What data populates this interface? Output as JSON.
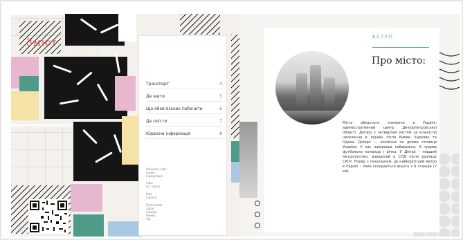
{
  "toc": {
    "title": "3міст",
    "items": [
      {
        "label": "Транспорт",
        "page": "4"
      },
      {
        "label": "Де жити",
        "page": "5"
      },
      {
        "label": "Що обов’язково побачити",
        "page": "6"
      },
      {
        "label": "Де поїсти",
        "page": "7"
      },
      {
        "label": "Корисна інформація",
        "page": "8"
      }
    ],
    "small_notes": [
      "Важлива інфо",
      "мафія",
      "Інформація",
      "Інфо",
      "всі також",
      "Ким",
      "Сервіси",
      "Поліграфія",
      "адрес",
      "номери",
      "Номер",
      "під"
    ]
  },
  "intro": {
    "label": "ВСТУП:",
    "title": "Про місто:",
    "body": "Місто обласного значення в Україні, адміністративний центр Дніпропетровської області. Дніпро є четвертим містом за кількістю населення в Україні після Києва, Харкова та Одеси. Дніпро — космічна та ділова столиця України. У нас найдовша набережна. Э чудова футбольна команда і річка. У Дніпрі – перший метрополітен, відкритий в СНД після розпаду СРСР. Поряд з генуезьким, це найкоротший метро в Європі – лінія складається всього з 6 станцій (7 км)."
  },
  "colors": {
    "accent_red": "#e0453f",
    "accent_teal": "#4aa3a7",
    "pink": "#e7b7cf",
    "teal": "#4f9b8a",
    "blue": "#aac8e3",
    "yellow": "#f4e2a6"
  }
}
